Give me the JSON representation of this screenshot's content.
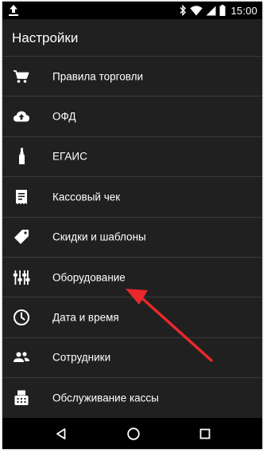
{
  "status_bar": {
    "time": "15:00",
    "icons": [
      "upload-icon",
      "bluetooth-icon",
      "wifi-icon",
      "signal-icon",
      "battery-icon"
    ]
  },
  "header": {
    "title": "Настройки"
  },
  "menu": {
    "items": [
      {
        "label": "Правила торговли",
        "icon": "cart-icon"
      },
      {
        "label": "ОФД",
        "icon": "cloud-upload-icon"
      },
      {
        "label": "ЕГАИС",
        "icon": "bottle-icon"
      },
      {
        "label": "Кассовый чек",
        "icon": "receipt-icon"
      },
      {
        "label": "Скидки и шаблоны",
        "icon": "tag-icon"
      },
      {
        "label": "Оборудование",
        "icon": "equalizer-icon"
      },
      {
        "label": "Дата и время",
        "icon": "clock-icon"
      },
      {
        "label": "Сотрудники",
        "icon": "people-icon"
      },
      {
        "label": "Обслуживание кассы",
        "icon": "fax-icon"
      }
    ]
  },
  "nav_bar": {
    "buttons": [
      "back-icon",
      "home-icon",
      "recents-icon"
    ]
  },
  "colors": {
    "background": "#202020",
    "status_bar": "#000000",
    "divider": "#3a3a3a",
    "text": "#ffffff",
    "annotation_arrow": "#e8282b"
  }
}
